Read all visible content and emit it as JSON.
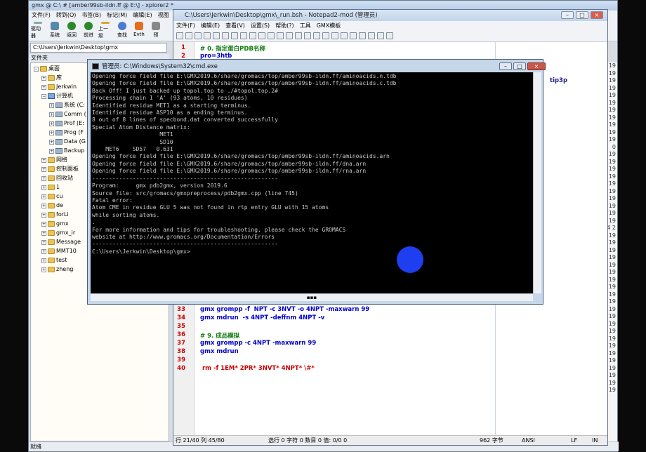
{
  "explorer": {
    "title": "gmx @ C:\\ # [amber99sb-ildn.ff @ E:\\] - xplorer2 *",
    "menu": [
      "文件(F)",
      "转到(O)",
      "书签(B)",
      "标记(M)",
      "编辑(E)",
      "视图"
    ],
    "toolbar": [
      "驱动器",
      "系统",
      "返回",
      "前进",
      "上一级",
      "查找",
      "Evth",
      "预"
    ],
    "address": "C:\\Users\\Jerkwin\\Desktop\\gmx",
    "tree_header": "文件夹",
    "tree": [
      {
        "label": "桌面",
        "kind": "folder"
      },
      {
        "label": "库",
        "kind": "folder"
      },
      {
        "label": "Jerkwin",
        "kind": "folder"
      },
      {
        "label": "计算机",
        "kind": "computer"
      },
      {
        "label": "系统 (C:",
        "kind": "drive"
      },
      {
        "label": "Comm (",
        "kind": "drive"
      },
      {
        "label": "Prof (E:",
        "kind": "drive"
      },
      {
        "label": "Prog (F",
        "kind": "drive"
      },
      {
        "label": "Data (G",
        "kind": "drive"
      },
      {
        "label": "Backup",
        "kind": "drive"
      },
      {
        "label": "网络",
        "kind": "folder"
      },
      {
        "label": "控制面板",
        "kind": "folder"
      },
      {
        "label": "回收站",
        "kind": "folder"
      },
      {
        "label": "1",
        "kind": "folder"
      },
      {
        "label": "cu",
        "kind": "folder"
      },
      {
        "label": "de",
        "kind": "folder"
      },
      {
        "label": "forLi",
        "kind": "folder"
      },
      {
        "label": "gmx",
        "kind": "folder"
      },
      {
        "label": "gmx_ir",
        "kind": "folder"
      },
      {
        "label": "Message",
        "kind": "folder"
      },
      {
        "label": "MMT10",
        "kind": "folder"
      },
      {
        "label": "test",
        "kind": "folder"
      },
      {
        "label": "zheng",
        "kind": "folder"
      }
    ],
    "right_strip": [
      "19",
      "19",
      "19",
      "19",
      "19",
      "19",
      "19",
      "19",
      "19",
      "19",
      "19",
      "0",
      "19",
      "19",
      "19",
      "19",
      "19",
      "19",
      "19",
      "19",
      "19",
      "19",
      "4 2",
      "19",
      "19",
      "19",
      "19",
      "19",
      "19",
      "19",
      "19",
      "19",
      "19",
      "19",
      "19",
      "19",
      "19",
      "19",
      "19",
      "19",
      "19",
      "19",
      "19",
      "19",
      "19"
    ],
    "status": "就绪"
  },
  "notepad": {
    "title": "C:\\Users\\Jerkwin\\Desktop\\gmx\\_run.bsh - Notepad2-mod (管理员)",
    "menu": [
      "文件(F)",
      "编辑(E)",
      "查看(V)",
      "设置(S)",
      "帮助(?)",
      "工具",
      "GMX模板"
    ],
    "lines": [
      {
        "n": "1",
        "text": "# 0. 指定蛋白PDB名称",
        "cls": "cm"
      },
      {
        "n": "2",
        "text": "pro=3htb",
        "cls": "kw"
      }
    ],
    "lines_bottom": [
      {
        "n": "33",
        "text": "gmx grompp -f  NPT -c 3NVT -o 4NPT -maxwarn 99",
        "cls": "kw"
      },
      {
        "n": "34",
        "text": "gmx mdrun  -s 4NPT -deffnm 4NPT -v",
        "cls": "kw"
      },
      {
        "n": "35",
        "text": "",
        "cls": "kw"
      },
      {
        "n": "36",
        "text": "# 9. 成品模拟",
        "cls": "cm"
      },
      {
        "n": "37",
        "text": "gmx grompp -c 4NPT -maxwarn 99",
        "cls": "kw"
      },
      {
        "n": "38",
        "text": "gmx mdrun",
        "cls": "kw"
      },
      {
        "n": "39",
        "text": "",
        "cls": "kw"
      },
      {
        "n": "40",
        "text": " rm -f 1EM* 2PR* 3NVT* 4NPT* \\#*",
        "cls": "hl"
      }
    ],
    "tail_text": "tip3p",
    "status": {
      "pos": "行 21/40  列 45/80",
      "sel": "选行 0  字符 0  数目 0  值: 0/0  0",
      "size": "962 字节",
      "enc": "ANSI",
      "eol": "LF",
      "mode": "IN"
    }
  },
  "cmd": {
    "title": "管理员: C:\\Windows\\System32\\cmd.exe",
    "lines": [
      "Opening force field file E:\\GMX2019.6/share/gromacs/top/amber99sb-ildn.ff/aminoacids.n.tdb",
      "Opening force field file E:\\GMX2019.6/share/gromacs/top/amber99sb-ildn.ff/aminoacids.c.tdb",
      "",
      "Back Off! I just backed up topol.top to ./#topol.top.2#",
      "Processing chain 1 'A' (93 atoms, 10 residues)",
      "Identified residue MET1 as a starting terminus.",
      "Identified residue ASP10 as a ending terminus.",
      "8 out of 8 lines of specbond.dat converted successfully",
      "Special Atom Distance matrix:",
      "                    MET1",
      "                    SD10",
      "    MET6    SD57   0.631",
      "Opening force field file E:\\GMX2019.6/share/gromacs/top/amber99sb-ildn.ff/aminoacids.arn",
      "Opening force field file E:\\GMX2019.6/share/gromacs/top/amber99sb-ildn.ff/dna.arn",
      "Opening force field file E:\\GMX2019.6/share/gromacs/top/amber99sb-ildn.ff/rna.arn",
      "",
      "-------------------------------------------------------",
      "",
      "Program:     gmx pdb2gmx, version 2019.6",
      "Source file: src/gromacs/gmxpreprocess/pdb2gmx.cpp (line 745)",
      "",
      "Fatal error:",
      "Atom CME in residue GLU 5 was not found in rtp entry GLU with 15 atoms",
      "while sorting atoms.",
      ".",
      "",
      "For more information and tips for troubleshooting, please check the GROMACS",
      "website at http://www.gromacs.org/Documentation/Errors",
      "-------------------------------------------------------",
      "",
      "C:\\Users\\Jerkwin\\Desktop\\gmx>"
    ]
  }
}
